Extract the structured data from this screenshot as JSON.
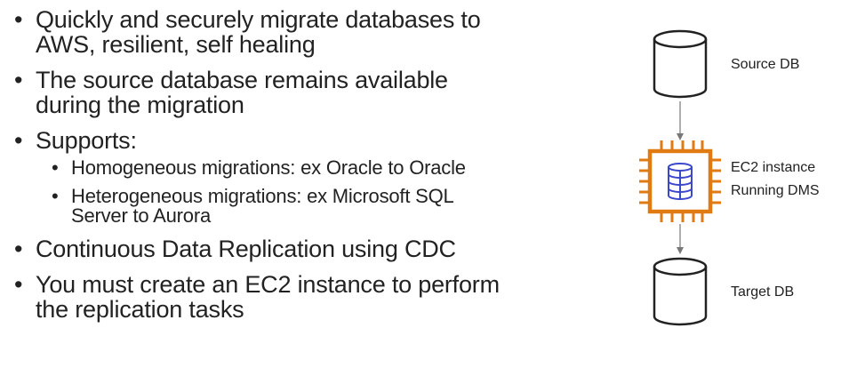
{
  "bullets": [
    {
      "text": "Quickly and securely migrate databases to AWS, resilient, self healing"
    },
    {
      "text": "The source database remains available during the migration"
    },
    {
      "text": "Supports:",
      "sub": [
        "Homogeneous migrations: ex Oracle to Oracle",
        "Heterogeneous migrations: ex Microsoft SQL Server to Aurora"
      ]
    },
    {
      "text": "Continuous Data Replication using CDC"
    },
    {
      "text": "You must create an EC2 instance to perform the replication tasks"
    }
  ],
  "diagram": {
    "source_label": "Source DB",
    "ec2_label_line1": "EC2 instance",
    "ec2_label_line2": "Running DMS",
    "target_label": "Target DB",
    "colors": {
      "chip": "#E07B14",
      "db_icon": "#3B48CC",
      "outline": "#222222",
      "arrow": "#777777"
    },
    "icons": [
      "database-cylinder-icon",
      "ec2-chip-icon",
      "database-stack-icon"
    ]
  }
}
